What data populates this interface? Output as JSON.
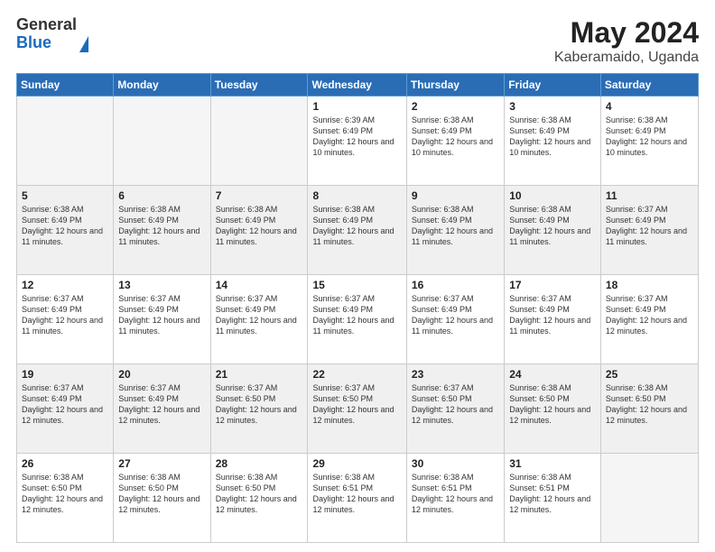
{
  "logo": {
    "general": "General",
    "blue": "Blue"
  },
  "title": "May 2024",
  "subtitle": "Kaberamaido, Uganda",
  "headers": [
    "Sunday",
    "Monday",
    "Tuesday",
    "Wednesday",
    "Thursday",
    "Friday",
    "Saturday"
  ],
  "weeks": [
    {
      "shaded": false,
      "days": [
        {
          "number": "",
          "info": "",
          "empty": true
        },
        {
          "number": "",
          "info": "",
          "empty": true
        },
        {
          "number": "",
          "info": "",
          "empty": true
        },
        {
          "number": "1",
          "info": "Sunrise: 6:39 AM\nSunset: 6:49 PM\nDaylight: 12 hours and 10 minutes."
        },
        {
          "number": "2",
          "info": "Sunrise: 6:38 AM\nSunset: 6:49 PM\nDaylight: 12 hours and 10 minutes."
        },
        {
          "number": "3",
          "info": "Sunrise: 6:38 AM\nSunset: 6:49 PM\nDaylight: 12 hours and 10 minutes."
        },
        {
          "number": "4",
          "info": "Sunrise: 6:38 AM\nSunset: 6:49 PM\nDaylight: 12 hours and 10 minutes."
        }
      ]
    },
    {
      "shaded": true,
      "days": [
        {
          "number": "5",
          "info": "Sunrise: 6:38 AM\nSunset: 6:49 PM\nDaylight: 12 hours and 11 minutes."
        },
        {
          "number": "6",
          "info": "Sunrise: 6:38 AM\nSunset: 6:49 PM\nDaylight: 12 hours and 11 minutes."
        },
        {
          "number": "7",
          "info": "Sunrise: 6:38 AM\nSunset: 6:49 PM\nDaylight: 12 hours and 11 minutes."
        },
        {
          "number": "8",
          "info": "Sunrise: 6:38 AM\nSunset: 6:49 PM\nDaylight: 12 hours and 11 minutes."
        },
        {
          "number": "9",
          "info": "Sunrise: 6:38 AM\nSunset: 6:49 PM\nDaylight: 12 hours and 11 minutes."
        },
        {
          "number": "10",
          "info": "Sunrise: 6:38 AM\nSunset: 6:49 PM\nDaylight: 12 hours and 11 minutes."
        },
        {
          "number": "11",
          "info": "Sunrise: 6:37 AM\nSunset: 6:49 PM\nDaylight: 12 hours and 11 minutes."
        }
      ]
    },
    {
      "shaded": false,
      "days": [
        {
          "number": "12",
          "info": "Sunrise: 6:37 AM\nSunset: 6:49 PM\nDaylight: 12 hours and 11 minutes."
        },
        {
          "number": "13",
          "info": "Sunrise: 6:37 AM\nSunset: 6:49 PM\nDaylight: 12 hours and 11 minutes."
        },
        {
          "number": "14",
          "info": "Sunrise: 6:37 AM\nSunset: 6:49 PM\nDaylight: 12 hours and 11 minutes."
        },
        {
          "number": "15",
          "info": "Sunrise: 6:37 AM\nSunset: 6:49 PM\nDaylight: 12 hours and 11 minutes."
        },
        {
          "number": "16",
          "info": "Sunrise: 6:37 AM\nSunset: 6:49 PM\nDaylight: 12 hours and 11 minutes."
        },
        {
          "number": "17",
          "info": "Sunrise: 6:37 AM\nSunset: 6:49 PM\nDaylight: 12 hours and 11 minutes."
        },
        {
          "number": "18",
          "info": "Sunrise: 6:37 AM\nSunset: 6:49 PM\nDaylight: 12 hours and 12 minutes."
        }
      ]
    },
    {
      "shaded": true,
      "days": [
        {
          "number": "19",
          "info": "Sunrise: 6:37 AM\nSunset: 6:49 PM\nDaylight: 12 hours and 12 minutes."
        },
        {
          "number": "20",
          "info": "Sunrise: 6:37 AM\nSunset: 6:49 PM\nDaylight: 12 hours and 12 minutes."
        },
        {
          "number": "21",
          "info": "Sunrise: 6:37 AM\nSunset: 6:50 PM\nDaylight: 12 hours and 12 minutes."
        },
        {
          "number": "22",
          "info": "Sunrise: 6:37 AM\nSunset: 6:50 PM\nDaylight: 12 hours and 12 minutes."
        },
        {
          "number": "23",
          "info": "Sunrise: 6:37 AM\nSunset: 6:50 PM\nDaylight: 12 hours and 12 minutes."
        },
        {
          "number": "24",
          "info": "Sunrise: 6:38 AM\nSunset: 6:50 PM\nDaylight: 12 hours and 12 minutes."
        },
        {
          "number": "25",
          "info": "Sunrise: 6:38 AM\nSunset: 6:50 PM\nDaylight: 12 hours and 12 minutes."
        }
      ]
    },
    {
      "shaded": false,
      "days": [
        {
          "number": "26",
          "info": "Sunrise: 6:38 AM\nSunset: 6:50 PM\nDaylight: 12 hours and 12 minutes."
        },
        {
          "number": "27",
          "info": "Sunrise: 6:38 AM\nSunset: 6:50 PM\nDaylight: 12 hours and 12 minutes."
        },
        {
          "number": "28",
          "info": "Sunrise: 6:38 AM\nSunset: 6:50 PM\nDaylight: 12 hours and 12 minutes."
        },
        {
          "number": "29",
          "info": "Sunrise: 6:38 AM\nSunset: 6:51 PM\nDaylight: 12 hours and 12 minutes."
        },
        {
          "number": "30",
          "info": "Sunrise: 6:38 AM\nSunset: 6:51 PM\nDaylight: 12 hours and 12 minutes."
        },
        {
          "number": "31",
          "info": "Sunrise: 6:38 AM\nSunset: 6:51 PM\nDaylight: 12 hours and 12 minutes."
        },
        {
          "number": "",
          "info": "",
          "empty": true
        }
      ]
    }
  ]
}
